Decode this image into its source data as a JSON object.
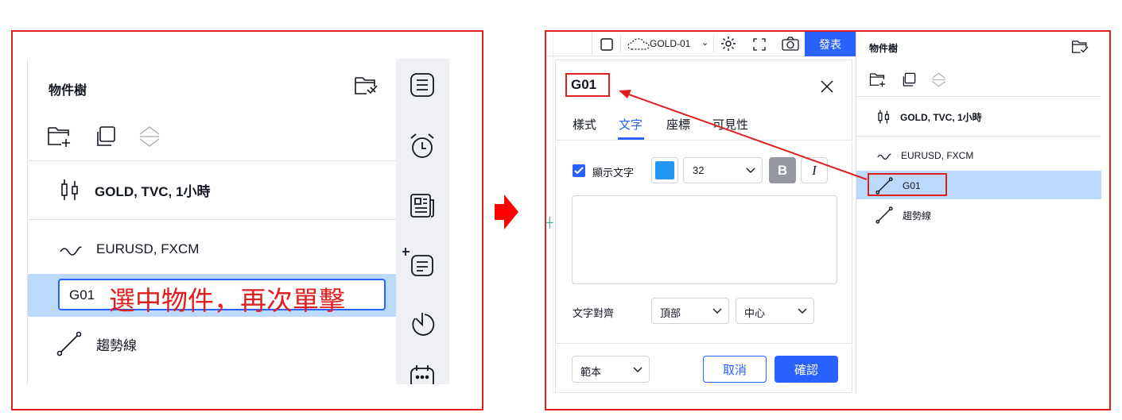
{
  "left_panel": {
    "title": "物件樹",
    "tree": {
      "symbol_label": "GOLD, TVC, 1小時",
      "eurusd_label": "EURUSD, FXCM",
      "editing_value": "G01",
      "annotation": "選中物件，再次單擊",
      "trendline_label": "趨勢線"
    }
  },
  "right_panel": {
    "toolbar": {
      "symbol": "GOLD-01",
      "publish_label": "發表"
    },
    "dialog": {
      "title": "G01",
      "tabs": [
        "樣式",
        "文字",
        "座標",
        "可見性"
      ],
      "active_tab": 1,
      "show_text_label": "顯示文字",
      "show_text_checked": true,
      "text_color": "#2196f3",
      "font_size": "32",
      "bold_label": "B",
      "italic_label": "I",
      "text_value": "",
      "align_label": "文字對齊",
      "vertical_align": "頂部",
      "horizontal_align": "中心",
      "template_label": "範本",
      "cancel_label": "取消",
      "ok_label": "確認"
    },
    "object_tree": {
      "title": "物件樹",
      "symbol_label": "GOLD, TVC, 1小時",
      "eurusd_label": "EURUSD, FXCM",
      "selected_label": "G01",
      "trendline_label": "趨勢線"
    }
  },
  "colors": {
    "annotation_red": "#e02020",
    "accent_blue": "#2962ff",
    "selected_row": "#bbd9fb"
  }
}
